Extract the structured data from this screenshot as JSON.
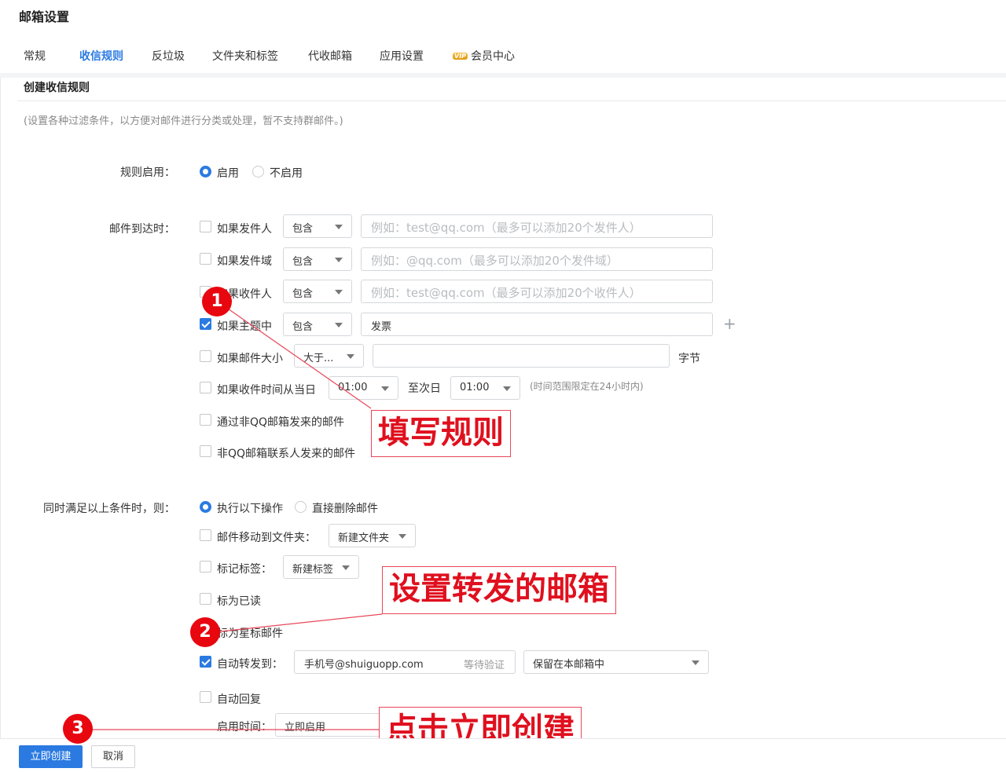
{
  "page": {
    "title": "邮箱设置"
  },
  "tabs": [
    {
      "label": "常规",
      "active": false
    },
    {
      "label": "收信规则",
      "active": true
    },
    {
      "label": "反垃圾",
      "active": false
    },
    {
      "label": "文件夹和标签",
      "active": false
    },
    {
      "label": "代收邮箱",
      "active": false
    },
    {
      "label": "应用设置",
      "active": false
    },
    {
      "label": "会员中心",
      "active": false,
      "badge": "VIP"
    }
  ],
  "section": {
    "title": "创建收信规则",
    "description": "(设置各种过滤条件，以方便对邮件进行分类或处理，暂不支持群邮件。)"
  },
  "rule_enable": {
    "label": "规则启用：",
    "options": [
      {
        "label": "启用",
        "selected": true
      },
      {
        "label": "不启用",
        "selected": false
      }
    ]
  },
  "conditions": {
    "label": "邮件到达时：",
    "sender": {
      "label": "如果发件人",
      "checked": false,
      "operator": "包含",
      "placeholder": "例如：test@qq.com（最多可以添加20个发件人）"
    },
    "sender_domain": {
      "label": "如果发件域",
      "checked": false,
      "operator": "包含",
      "placeholder": "例如：@qq.com（最多可以添加20个发件域）"
    },
    "recipient": {
      "label": "如果收件人",
      "checked": false,
      "operator": "包含",
      "placeholder": "例如：test@qq.com（最多可以添加20个收件人）"
    },
    "subject": {
      "label": "如果主题中",
      "checked": true,
      "operator": "包含",
      "value": "发票"
    },
    "size": {
      "label": "如果邮件大小",
      "checked": false,
      "operator": "大于...",
      "unit": "字节"
    },
    "time": {
      "label": "如果收件时间从当日",
      "checked": false,
      "from": "01:00",
      "to_label": "至次日",
      "to": "01:00",
      "hint": "(时间范围限定在24小时内)"
    },
    "non_qq": {
      "label": "通过非QQ邮箱发来的邮件",
      "checked": false
    },
    "non_contact": {
      "label": "非QQ邮箱联系人发来的邮件",
      "checked": false
    }
  },
  "actions": {
    "label": "同时满足以上条件时，则：",
    "mode": [
      {
        "label": "执行以下操作",
        "selected": true
      },
      {
        "label": "直接删除邮件",
        "selected": false
      }
    ],
    "move": {
      "label": "邮件移动到文件夹：",
      "checked": false,
      "value": "新建文件夹"
    },
    "tag": {
      "label": "标记标签：",
      "checked": false,
      "value": "新建标签"
    },
    "read": {
      "label": "标为已读",
      "checked": false
    },
    "star": {
      "label": "标为星标邮件",
      "checked": false
    },
    "forward": {
      "label": "自动转发到：",
      "checked": true,
      "value": "手机号@shuiguopp.com",
      "status": "等待验证",
      "keep": "保留在本邮箱中"
    },
    "reply": {
      "label": "自动回复",
      "checked": false
    },
    "enable_time": {
      "label": "启用时间：",
      "value": "立即启用"
    }
  },
  "annotations": {
    "step1": {
      "number": "1",
      "text": "填写规则"
    },
    "step2": {
      "number": "2",
      "text": "设置转发的邮箱"
    },
    "step3": {
      "number": "3",
      "text": "点击立即创建"
    },
    "color": "#e0101e"
  },
  "footer": {
    "create_label": "立即创建",
    "cancel_label": "取消"
  },
  "colors": {
    "accent": "#2a7ae2",
    "annotation": "#e0101e"
  }
}
